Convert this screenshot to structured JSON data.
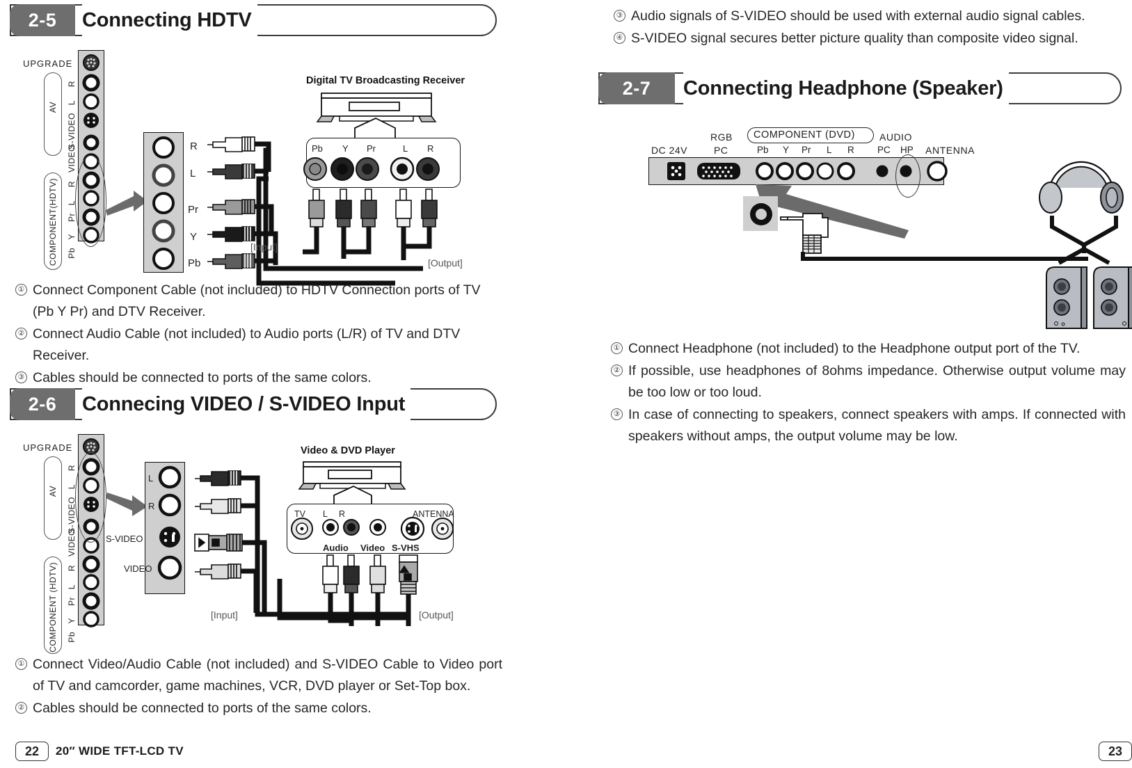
{
  "document": {
    "type": "tv-user-manual-spread",
    "left_page_number": "22",
    "right_page_number": "23",
    "footer_model": "20″ WIDE TFT-LCD TV"
  },
  "sections": [
    {
      "id": "2-5",
      "number": "2-5",
      "title": "Connecting HDTV",
      "instructions": [
        {
          "marker": "①",
          "text": "Connect Component Cable (not included) to HDTV Connection ports of TV (Pb Y Pr) and DTV Receiver."
        },
        {
          "marker": "②",
          "text": "Connect Audio Cable (not included) to Audio ports (L/R) of TV and DTV Receiver."
        },
        {
          "marker": "③",
          "text": "Cables should be connected to ports of the same colors."
        }
      ],
      "diagram": {
        "tv_panel_labels": [
          "UPGRADE",
          "AV",
          "R",
          "L",
          "S-VIDEO",
          "VIDEO",
          "R",
          "L",
          "Pr",
          "Y",
          "Pb"
        ],
        "tv_panel_groups": [
          "AV",
          "COMPONENT(HDTV)"
        ],
        "detail_labels": [
          "R",
          "L",
          "Pr",
          "Y",
          "Pb"
        ],
        "device_label": "Digital TV Broadcasting Receiver",
        "device_port_labels": [
          "Pb",
          "Y",
          "Pr",
          "L",
          "R"
        ],
        "input_label": "[Input]",
        "output_label": "[Output]"
      }
    },
    {
      "id": "2-6",
      "number": "2-6",
      "title": "Connecing VIDEO / S-VIDEO Input",
      "instructions": [
        {
          "marker": "①",
          "text": "Connect Video/Audio Cable (not included) and S-VIDEO Cable to Video port of TV and camcorder, game machines, VCR, DVD player or Set-Top box."
        },
        {
          "marker": "②",
          "text": "Cables should be connected to ports of the same colors."
        }
      ],
      "diagram": {
        "tv_panel_labels": [
          "UPGRADE",
          "AV",
          "R",
          "L",
          "S-VIDEO",
          "VIDEO",
          "R",
          "L",
          "Pr",
          "Y",
          "Pb"
        ],
        "tv_panel_groups": [
          "AV",
          "COMPONENT (HDTV)"
        ],
        "detail_labels": [
          "L",
          "R",
          "S-VIDEO",
          "VIDEO"
        ],
        "device_label": "Video & DVD Player",
        "device_port_labels": [
          "TV",
          "L",
          "R",
          "ANTENNA"
        ],
        "device_port_sublabels": [
          "Audio",
          "Video",
          "S-VHS"
        ],
        "input_label": "[Input]",
        "output_label": "[Output]"
      }
    },
    {
      "id": "2-7",
      "number": "2-7",
      "title": "Connecting Headphone (Speaker)",
      "instructions": [
        {
          "marker": "①",
          "text": "Connect Headphone (not included) to the Headphone output port of the TV."
        },
        {
          "marker": "②",
          "text": "If possible, use headphones of 8ohms impedance. Otherwise output volume may be too low or too loud."
        },
        {
          "marker": "③",
          "text": "In case of connecting to speakers, connect speakers with amps. If connected with speakers without amps, the output volume may be low."
        }
      ],
      "diagram": {
        "rear_panel_labels": [
          "DC 24V",
          "RGB",
          "PC",
          "COMPONENT (DVD)",
          "Pb",
          "Y",
          "Pr",
          "L",
          "R",
          "AUDIO",
          "PC",
          "HP",
          "ANTENNA"
        ]
      }
    }
  ],
  "carryover_instructions": [
    {
      "marker": "③",
      "text": "Audio signals of S-VIDEO should be used with external audio signal cables."
    },
    {
      "marker": "④",
      "text": "S-VIDEO signal secures better picture quality than composite video signal."
    }
  ],
  "colors": {
    "header_badge": "#6e6e6e",
    "header_border": "#3c3c3c",
    "panel_gray": "#cfcfcf",
    "text": "#1a1a1a",
    "arrow_gray": "#6b6b6b"
  }
}
